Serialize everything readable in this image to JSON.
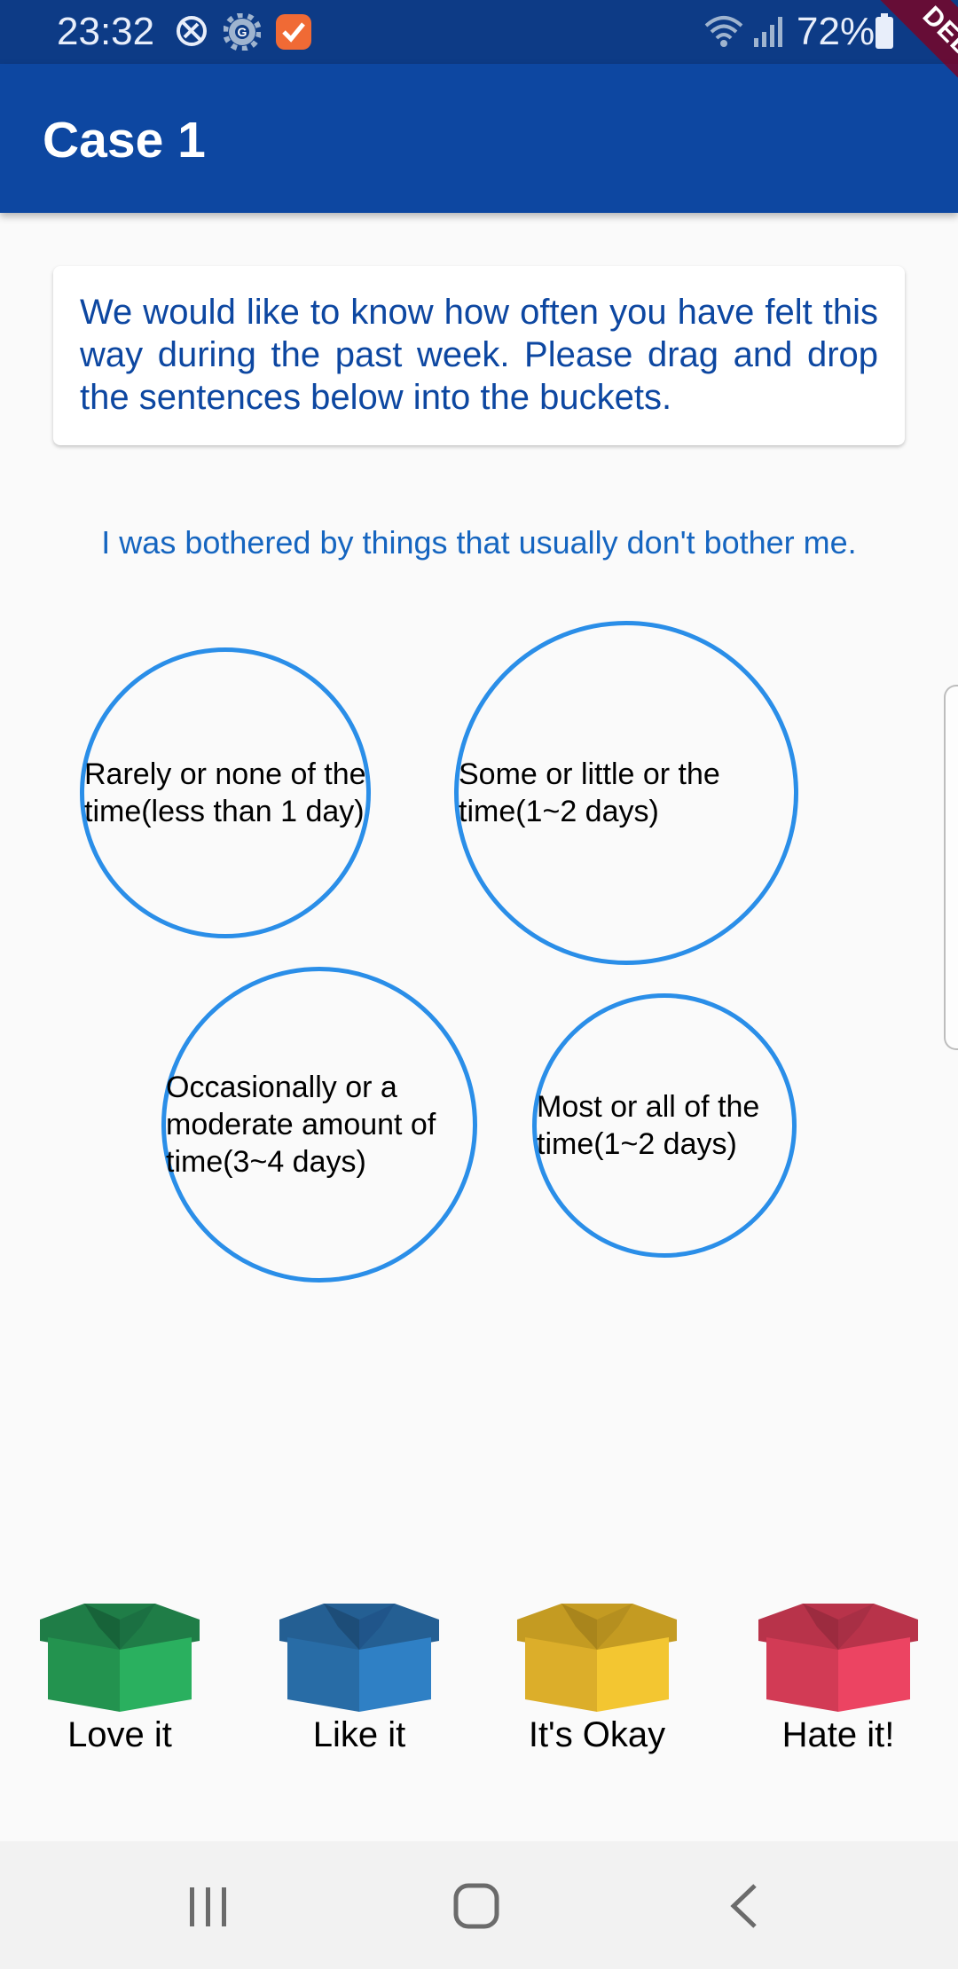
{
  "status_bar": {
    "time": "23:32",
    "battery_percent": "72%",
    "icons": [
      "sync-disabled-icon",
      "gear-icon",
      "notification-app-icon",
      "wifi-icon",
      "signal-icon",
      "battery-icon"
    ]
  },
  "debug_banner": "DEBUG",
  "app_bar": {
    "title": "Case 1"
  },
  "instruction": "We would like to know how often you have felt this way during the past week. Please drag and drop the sentences below into the buckets.",
  "question": "I was bothered by things that usually don't bother me.",
  "bubbles": [
    {
      "label": "Rarely or none of the time(less than 1 day)"
    },
    {
      "label": "Some or little or the time(1~2 days)"
    },
    {
      "label": "Occasionally or a moderate amount of time(3~4 days)"
    },
    {
      "label": "Most or all of the time(1~2 days)"
    }
  ],
  "buckets": [
    {
      "label": "Love it",
      "color": "#27a35b",
      "dark": "#1f7d47"
    },
    {
      "label": "Like it",
      "color": "#2f7fc3",
      "dark": "#245f93"
    },
    {
      "label": "It's Okay",
      "color": "#f1c232",
      "dark": "#c49b22"
    },
    {
      "label": "Hate it!",
      "color": "#e9435f",
      "dark": "#b8334a"
    }
  ],
  "nav": {
    "icons": [
      "recent-apps-icon",
      "home-icon",
      "back-icon"
    ]
  }
}
